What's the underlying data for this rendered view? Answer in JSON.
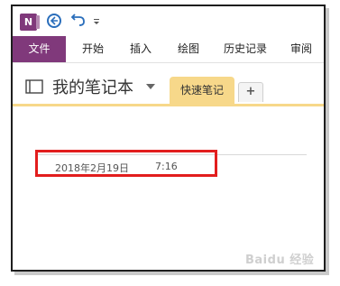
{
  "app": {
    "logo_letter": "N"
  },
  "ribbon": {
    "tabs": [
      {
        "label": "文件",
        "active": true
      },
      {
        "label": "开始"
      },
      {
        "label": "插入"
      },
      {
        "label": "绘图"
      },
      {
        "label": "历史记录"
      },
      {
        "label": "审阅"
      }
    ]
  },
  "notebook": {
    "title": "我的笔记本",
    "section_tab": "快速笔记",
    "add_tab": "+"
  },
  "page": {
    "date": "2018年2月19日",
    "time": "7:16"
  },
  "watermark": {
    "text": "Baidu 经验"
  },
  "colors": {
    "onenote_purple": "#80397b",
    "section_yellow": "#f7d88a",
    "highlight_red": "#e21d1d",
    "back_blue": "#2a6ebb"
  },
  "icons": [
    "onenote-logo-icon",
    "back-arrow-icon",
    "undo-icon",
    "qat-dropdown-icon",
    "notebook-icon",
    "dropdown-arrow-icon"
  ]
}
